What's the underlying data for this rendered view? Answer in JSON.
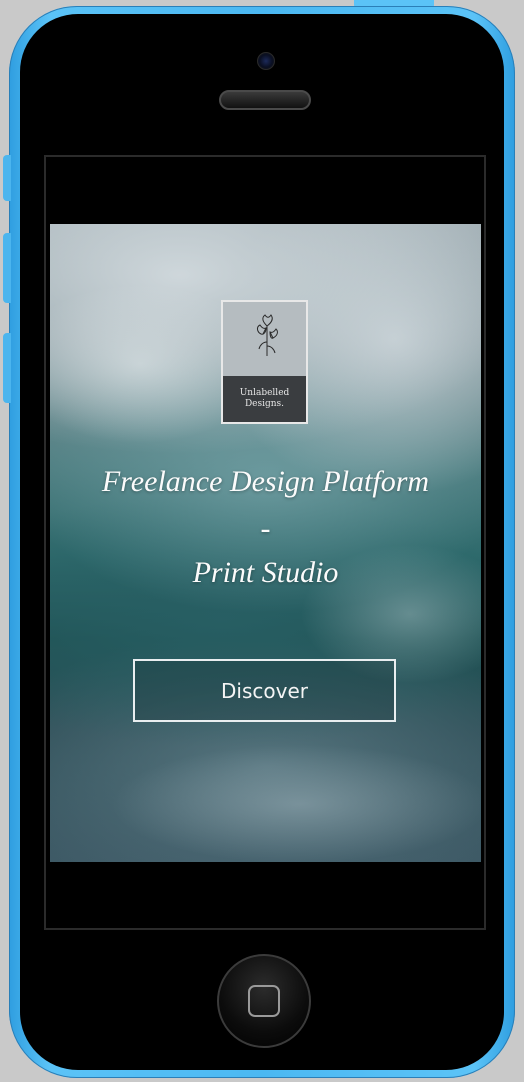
{
  "device": {
    "shell_color": "#4bb8f2",
    "face_color": "#000000"
  },
  "logo": {
    "line1": "Unlabelled",
    "line2": "Designs."
  },
  "hero": {
    "headline_line1": "Freelance Design Platform",
    "headline_separator": "-",
    "headline_line2": "Print Studio",
    "cta_label": "Discover"
  },
  "icons": {
    "logo_mark": "flower-icon",
    "home": "home-button-square-icon"
  }
}
